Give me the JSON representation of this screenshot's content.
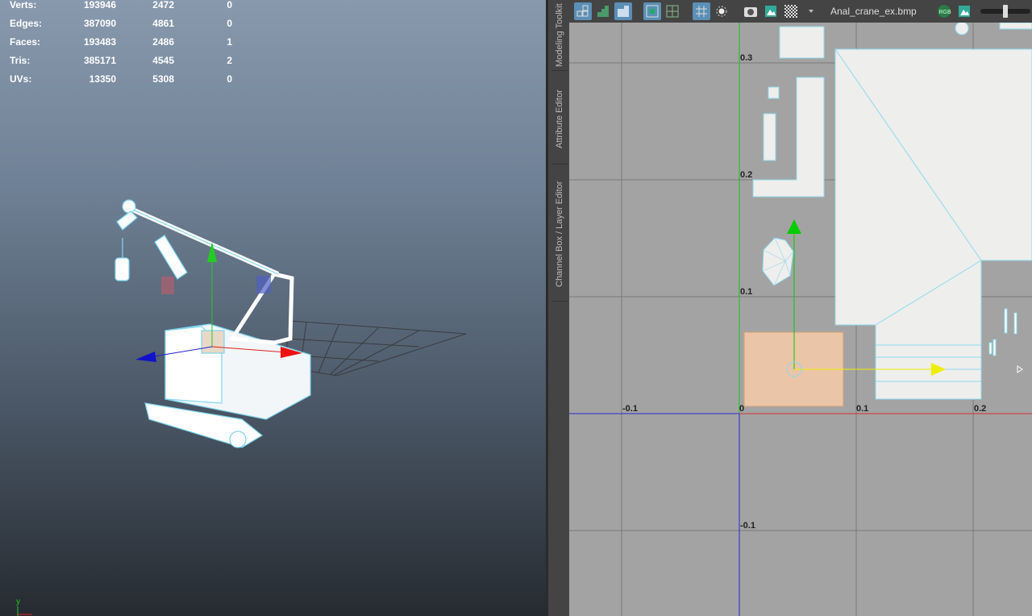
{
  "viewport": {
    "stats": [
      {
        "label": "Verts:",
        "a": "193946",
        "b": "2472",
        "c": "0"
      },
      {
        "label": "Edges:",
        "a": "387090",
        "b": "4861",
        "c": "0"
      },
      {
        "label": "Faces:",
        "a": "193483",
        "b": "2486",
        "c": "1"
      },
      {
        "label": "Tris:",
        "a": "385171",
        "b": "4545",
        "c": "2"
      },
      {
        "label": "UVs:",
        "a": "13350",
        "b": "5308",
        "c": "0"
      }
    ],
    "axis_y": "y"
  },
  "side_tabs": [
    "Modeling Toolkit",
    "Attribute Editor",
    "Channel Box / Layer Editor"
  ],
  "uv_editor": {
    "texture_name": "Anal_crane_ex.bmp",
    "icons": [
      "uv-shell-icon",
      "uv-select-icon",
      "uv-shaded-icon",
      "uv-grid-icon",
      "uv-display-icon",
      "grid-snap-icon",
      "pivot-icon",
      "snapshot-icon",
      "image-icon",
      "checker-icon",
      "dropdown-icon",
      "rgb-channel-icon",
      "image-alpha-icon",
      "exposure-slider"
    ],
    "x_labels": [
      "-0.1",
      "0",
      "0.1",
      "0.2"
    ],
    "y_labels": [
      "0.3",
      "0.2",
      "0.1",
      "-0.1"
    ],
    "colors": {
      "u_axis": "#d03030",
      "v_axis": "#2020d0",
      "selection": "#f3c9a8",
      "gizmo_x": "#ffff00",
      "gizmo_y": "#00cc00"
    }
  }
}
